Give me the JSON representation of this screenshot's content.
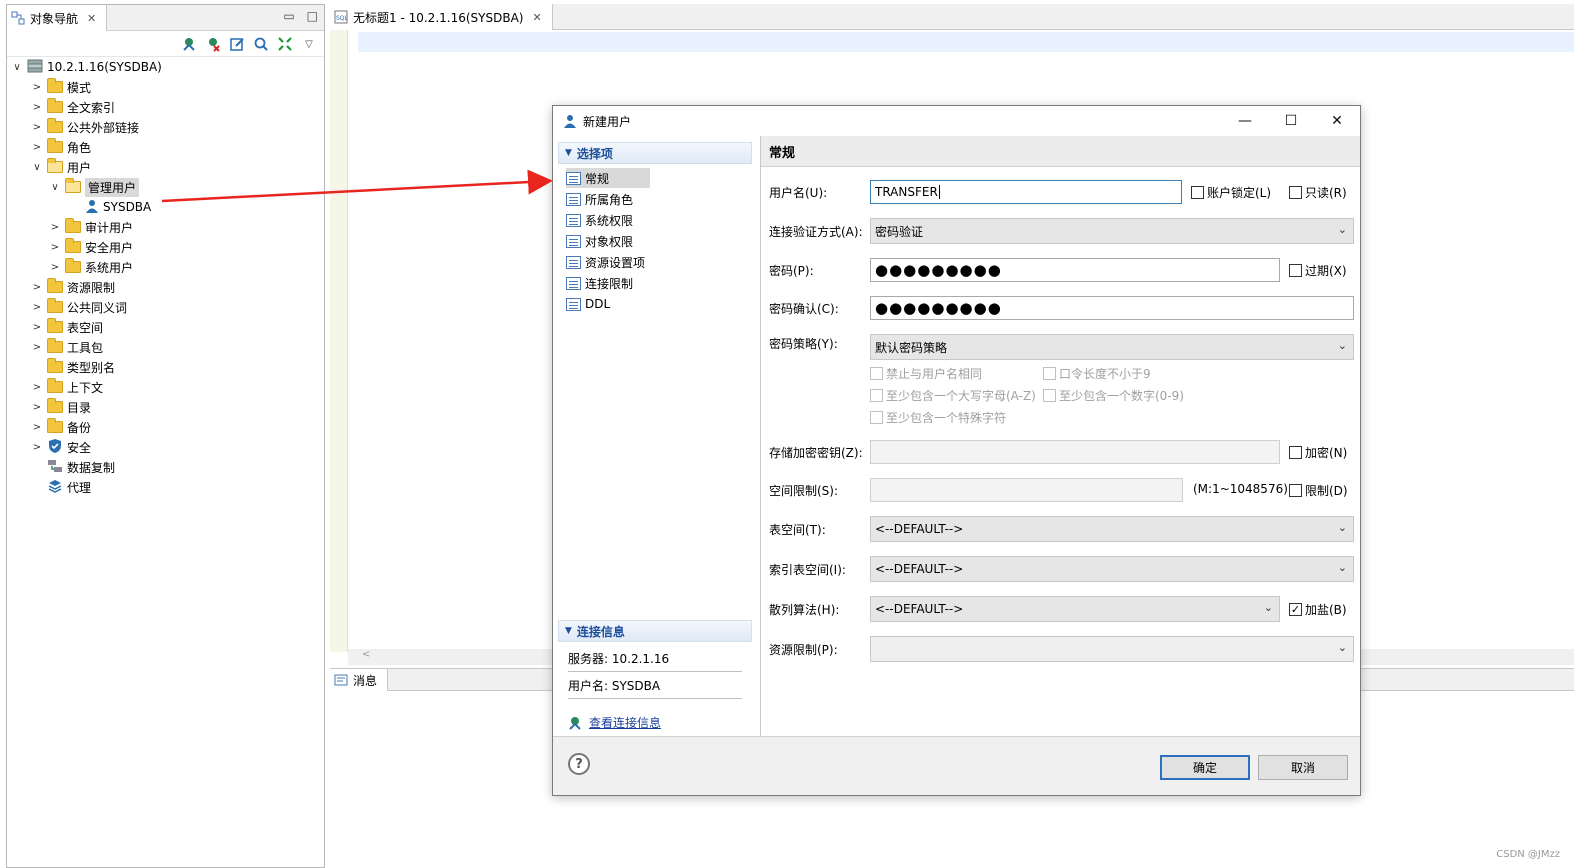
{
  "navigator": {
    "tab_label": "对象导航",
    "tree": [
      {
        "label": "10.2.1.16(SYSDBA)",
        "icon": "server-icon"
      },
      {
        "label": "模式",
        "icon": "folder-icon"
      },
      {
        "label": "全文索引",
        "icon": "folder-icon"
      },
      {
        "label": "公共外部链接",
        "icon": "folder-icon"
      },
      {
        "label": "角色",
        "icon": "folder-icon"
      },
      {
        "label": "用户",
        "icon": "folder-open-icon"
      },
      {
        "label": "管理用户",
        "icon": "folder-open-icon"
      },
      {
        "label": "SYSDBA",
        "icon": "user-icon"
      },
      {
        "label": "审计用户",
        "icon": "folder-icon"
      },
      {
        "label": "安全用户",
        "icon": "folder-icon"
      },
      {
        "label": "系统用户",
        "icon": "folder-icon"
      },
      {
        "label": "资源限制",
        "icon": "folder-icon"
      },
      {
        "label": "公共同义词",
        "icon": "folder-icon"
      },
      {
        "label": "表空间",
        "icon": "folder-icon"
      },
      {
        "label": "工具包",
        "icon": "folder-icon"
      },
      {
        "label": "类型别名",
        "icon": "folder-icon"
      },
      {
        "label": "上下文",
        "icon": "folder-icon"
      },
      {
        "label": "目录",
        "icon": "folder-icon"
      },
      {
        "label": "备份",
        "icon": "folder-icon"
      },
      {
        "label": "安全",
        "icon": "shield-icon"
      },
      {
        "label": "数据复制",
        "icon": "replication-icon"
      },
      {
        "label": "代理",
        "icon": "agent-icon"
      }
    ]
  },
  "editor": {
    "tab_label": "无标题1 - 10.2.1.16(SYSDBA)"
  },
  "messages": {
    "tab_label": "消息"
  },
  "dialog": {
    "title": "新建用户",
    "options_header": "选择项",
    "options": [
      "常规",
      "所属角色",
      "系统权限",
      "对象权限",
      "资源设置项",
      "连接限制",
      "DDL"
    ],
    "conn_header": "连接信息",
    "server_line": "服务器: 10.2.1.16",
    "user_line": "用户名: SYSDBA",
    "view_conn_link": "查看连接信息",
    "page_title": "常规",
    "fields": {
      "username_label": "用户名(U):",
      "username_value": "TRANSFER",
      "account_lock": "账户锁定(L)",
      "readonly": "只读(R)",
      "auth_label": "连接验证方式(A):",
      "auth_value": "密码验证",
      "password_label": "密码(P):",
      "password_value": "●●●●●●●●●",
      "expired": "过期(X)",
      "confirm_label": "密码确认(C):",
      "confirm_value": "●●●●●●●●●",
      "policy_label": "密码策略(Y):",
      "policy_value": "默认密码策略",
      "policy_opt1": "禁止与用户名相同",
      "policy_opt2": "口令长度不小于9",
      "policy_opt3": "至少包含一个大写字母(A-Z)",
      "policy_opt4": "至少包含一个数字(0-9)",
      "policy_opt5": "至少包含一个特殊字符",
      "storage_key_label": "存储加密密钥(Z):",
      "encrypt": "加密(N)",
      "space_label": "空间限制(S):",
      "space_range": "(M:1~1048576)",
      "limit": "限制(D)",
      "tablespace_label": "表空间(T):",
      "tablespace_value": "<--DEFAULT-->",
      "index_tablespace_label": "索引表空间(I):",
      "index_tablespace_value": "<--DEFAULT-->",
      "hash_label": "散列算法(H):",
      "hash_value": "<--DEFAULT-->",
      "salt": "加盐(B)",
      "resource_label": "资源限制(P):",
      "resource_value": ""
    },
    "ok": "确定",
    "cancel": "取消"
  },
  "watermark": "CSDN @JMzz",
  "colors": {
    "accent": "#2f6fbf",
    "arrow": "#e8261f",
    "folder": "#f2c53d"
  }
}
